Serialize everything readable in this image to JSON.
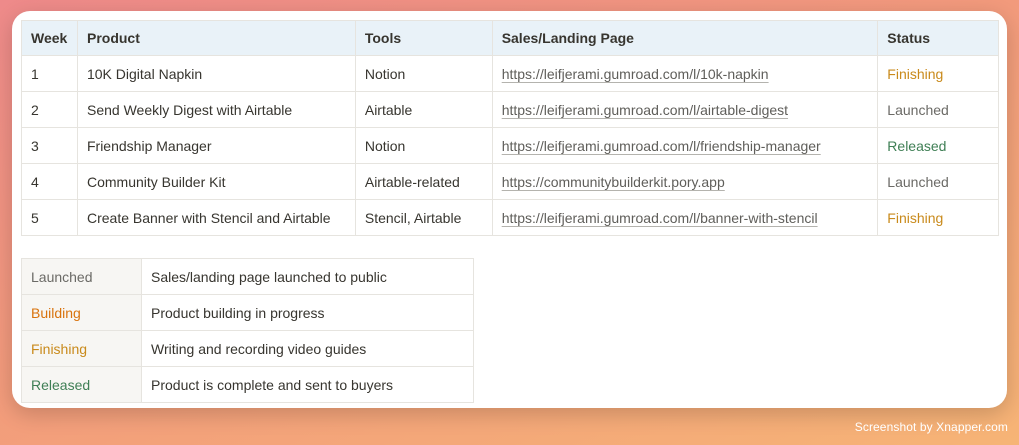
{
  "main_table": {
    "headers": [
      "Week",
      "Product",
      "Tools",
      "Sales/Landing Page",
      "Status"
    ],
    "rows": [
      {
        "week": "1",
        "product": "10K Digital Napkin",
        "tools": "Notion",
        "url": "https://leifjerami.gumroad.com/l/10k-napkin",
        "status": "Finishing",
        "status_color": "#c98a1b"
      },
      {
        "week": "2",
        "product": "Send Weekly Digest with Airtable",
        "tools": "Airtable",
        "url": "https://leifjerami.gumroad.com/l/airtable-digest",
        "status": "Launched",
        "status_color": "#6b6a66"
      },
      {
        "week": "3",
        "product": "Friendship Manager",
        "tools": "Notion",
        "url": "https://leifjerami.gumroad.com/l/friendship-manager",
        "status": "Released",
        "status_color": "#3f7f55"
      },
      {
        "week": "4",
        "product": "Community Builder Kit",
        "tools": "Airtable-related",
        "url": "https://communitybuilderkit.pory.app",
        "status": "Launched",
        "status_color": "#6b6a66"
      },
      {
        "week": "5",
        "product": "Create Banner with Stencil and Airtable",
        "tools": "Stencil, Airtable",
        "url": "https://leifjerami.gumroad.com/l/banner-with-stencil",
        "status": "Finishing",
        "status_color": "#c98a1b"
      }
    ]
  },
  "legend": [
    {
      "status": "Launched",
      "description": "Sales/landing page launched to public",
      "status_color": "#6b6a66"
    },
    {
      "status": "Building",
      "description": "Product building in progress",
      "status_color": "#d9730d"
    },
    {
      "status": "Finishing",
      "description": "Writing and recording video guides",
      "status_color": "#c98a1b"
    },
    {
      "status": "Released",
      "description": "Product is complete and sent to buyers",
      "status_color": "#3f7f55"
    }
  ],
  "watermark": "Screenshot by Xnapper.com"
}
